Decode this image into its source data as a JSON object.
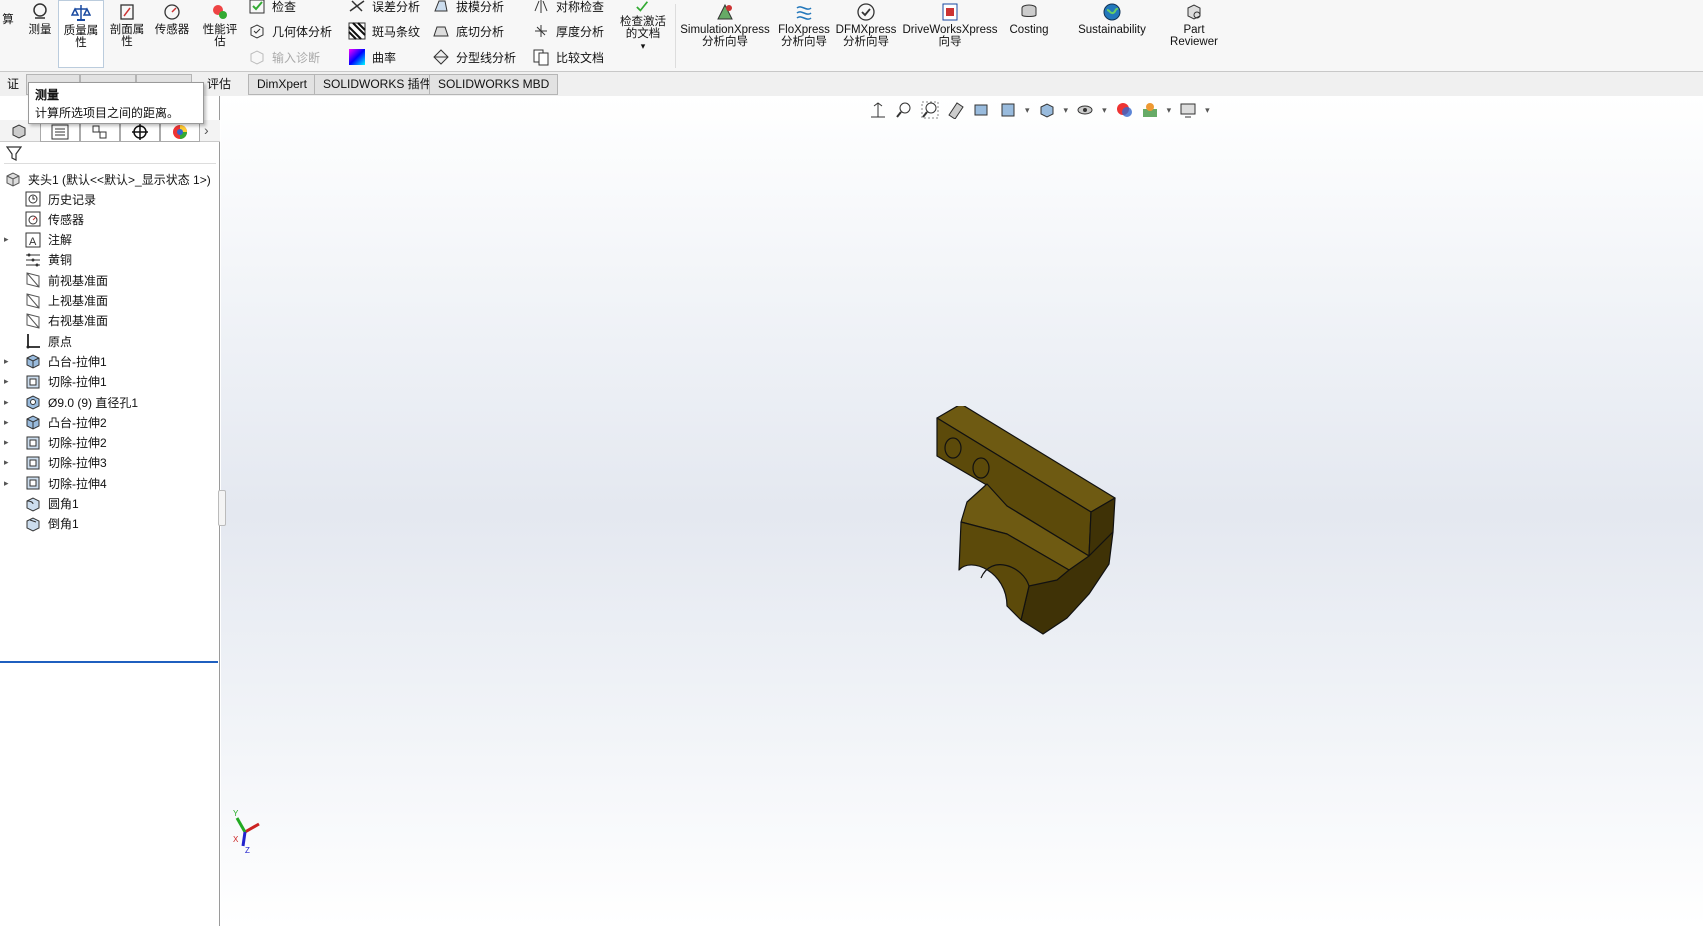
{
  "ribbon": {
    "calc_partial": "算",
    "measure": "测量",
    "mass_props": "质量属性",
    "section_props": "剖面属性",
    "sensor": "传感器",
    "perf_eval": "性能评估",
    "check": "检查",
    "geometry_analysis": "几何体分析",
    "import_diag": "输入诊断",
    "deviation": "误差分析",
    "zebra": "斑马条纹",
    "curvature": "曲率",
    "draft": "拔模分析",
    "undercut": "底切分析",
    "parting_line": "分型线分析",
    "symmetry": "对称检查",
    "thickness": "厚度分析",
    "compare": "比较文档",
    "check_active": "检查激活的文档",
    "simulation": "SimulationXpress 分析向导",
    "flo": "FloXpress 分析向导",
    "dfm": "DFMXpress 分析向导",
    "driveworks": "DriveWorksXpress 向导",
    "costing": "Costing",
    "sustainability": "Sustainability",
    "part_reviewer": "Part Reviewer"
  },
  "tabs": {
    "t0": "证",
    "t1": "",
    "t2": "",
    "t3": "",
    "evaluate": "评估",
    "dimxpert": "DimXpert",
    "addins": "SOLIDWORKS 插件",
    "mbd": "SOLIDWORKS MBD"
  },
  "tooltip": {
    "title": "测量",
    "desc": "计算所选项目之间的距离。"
  },
  "tree": {
    "root": "夹头1 (默认<<默认>_显示状态 1>)",
    "items": [
      {
        "label": "历史记录",
        "icon": "history-icon",
        "expand": false
      },
      {
        "label": "传感器",
        "icon": "sensor-icon",
        "expand": false
      },
      {
        "label": "注解",
        "icon": "annotation-icon",
        "expand": true
      },
      {
        "label": "黄铜",
        "icon": "material-icon",
        "expand": false
      },
      {
        "label": "前视基准面",
        "icon": "plane-icon",
        "expand": false
      },
      {
        "label": "上视基准面",
        "icon": "plane-icon",
        "expand": false
      },
      {
        "label": "右视基准面",
        "icon": "plane-icon",
        "expand": false
      },
      {
        "label": "原点",
        "icon": "origin-icon",
        "expand": false
      },
      {
        "label": "凸台-拉伸1",
        "icon": "boss-extrude-icon",
        "expand": true
      },
      {
        "label": "切除-拉伸1",
        "icon": "cut-extrude-icon",
        "expand": true
      },
      {
        "label": "Ø9.0 (9) 直径孔1",
        "icon": "hole-icon",
        "expand": true
      },
      {
        "label": "凸台-拉伸2",
        "icon": "boss-extrude-icon",
        "expand": true
      },
      {
        "label": "切除-拉伸2",
        "icon": "cut-extrude-icon",
        "expand": true
      },
      {
        "label": "切除-拉伸3",
        "icon": "cut-extrude-icon",
        "expand": true
      },
      {
        "label": "切除-拉伸4",
        "icon": "cut-extrude-icon",
        "expand": true
      },
      {
        "label": "圆角1",
        "icon": "fillet-icon",
        "expand": false
      },
      {
        "label": "倒角1",
        "icon": "chamfer-icon",
        "expand": false
      }
    ]
  },
  "triad": {
    "x": "X",
    "y": "Y",
    "z": "Z"
  },
  "colors": {
    "part": "#5c4a0a",
    "part_top": "#6e5a12",
    "part_dark": "#3f3206"
  }
}
